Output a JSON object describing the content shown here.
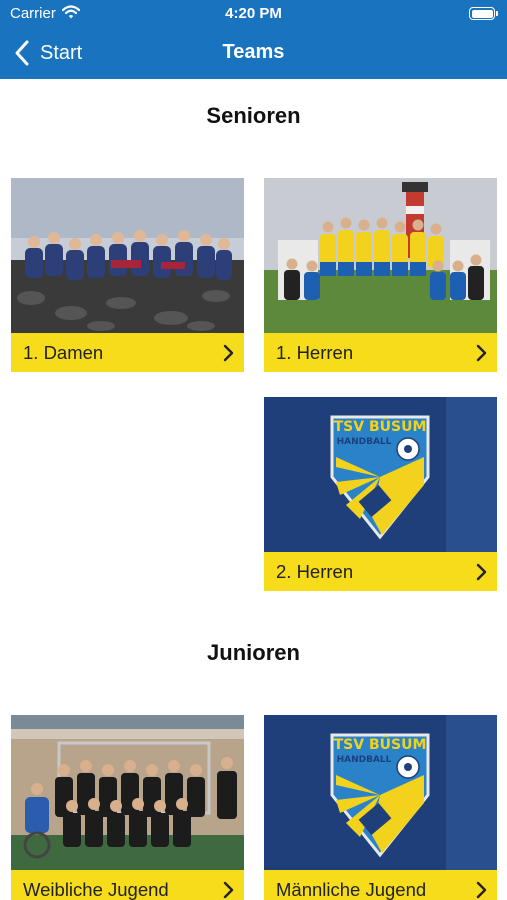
{
  "status_bar": {
    "carrier": "Carrier",
    "time": "4:20 PM"
  },
  "nav": {
    "back_label": "Start",
    "title": "Teams"
  },
  "sections": [
    {
      "title": "Senioren",
      "cards": [
        {
          "label": "1. Damen",
          "image": "team-photo-seawall"
        },
        {
          "label": "1. Herren",
          "image": "team-photo-lighthouse"
        },
        {
          "label": "2. Herren",
          "image": "club-logo"
        }
      ]
    },
    {
      "title": "Junioren",
      "cards": [
        {
          "label": "Weibliche Jugend",
          "image": "team-photo-gym"
        },
        {
          "label": "Männliche Jugend",
          "image": "club-logo"
        }
      ]
    }
  ],
  "logo": {
    "line1": "TSV BÜSUM",
    "line2": "HANDBALL"
  },
  "colors": {
    "nav": "#1a73bf",
    "label_bg": "#f6dc1b",
    "logo_bg": "#1f3f7a"
  }
}
